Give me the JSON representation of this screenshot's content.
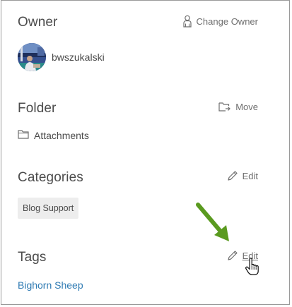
{
  "owner": {
    "heading": "Owner",
    "action_label": "Change Owner",
    "action_icon": "user-icon",
    "username": "bwszukalski"
  },
  "folder": {
    "heading": "Folder",
    "action_label": "Move",
    "action_icon": "move-folder-icon",
    "name": "Attachments",
    "name_icon": "folder-icon"
  },
  "categories": {
    "heading": "Categories",
    "action_label": "Edit",
    "action_icon": "pencil-icon",
    "items": [
      "Blog Support"
    ]
  },
  "tags": {
    "heading": "Tags",
    "action_label": "Edit",
    "action_icon": "pencil-icon",
    "items": [
      "Bighorn Sheep"
    ]
  },
  "colors": {
    "link": "#2f7bb3",
    "annotation_arrow": "#5a9a1f",
    "chip_bg": "#ededed",
    "border": "#9a9a9a"
  }
}
